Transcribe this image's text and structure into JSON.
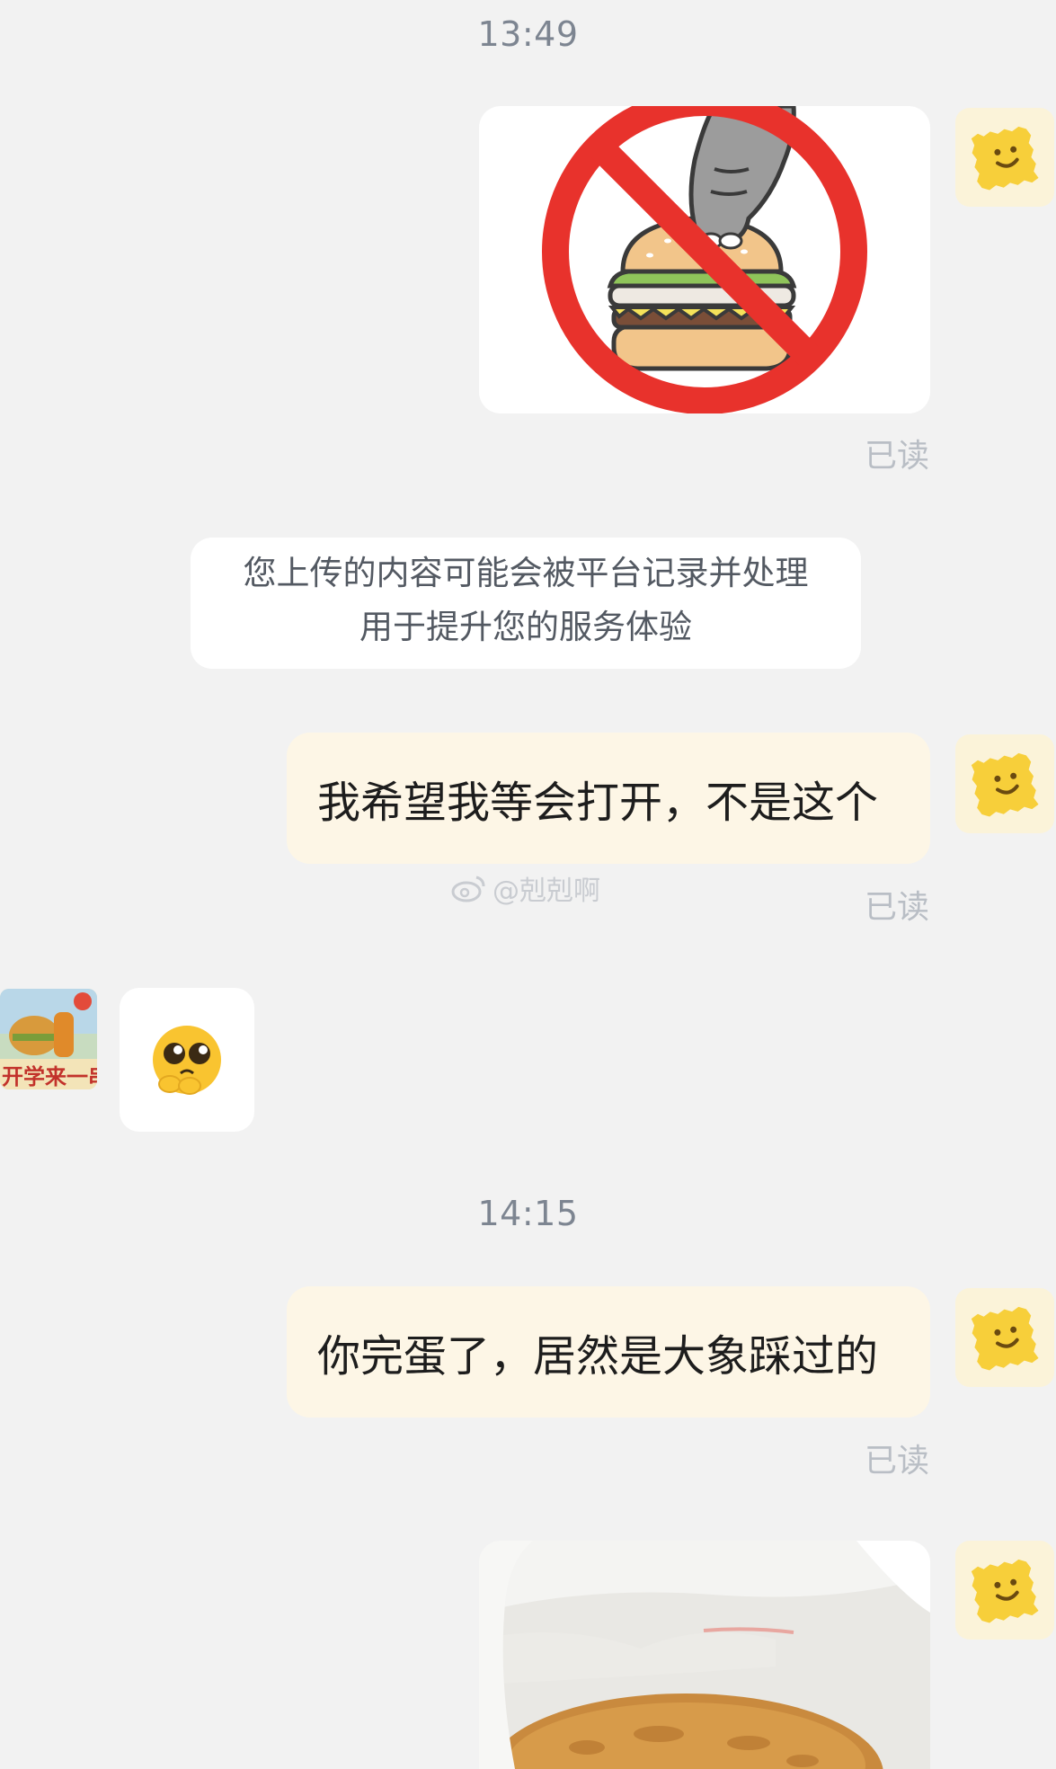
{
  "messages": {
    "time_1": "13:49",
    "read_1": "已读",
    "notice_line1": "您上传的内容可能会被平台记录并处理",
    "notice_line2": "用于提升您的服务体验",
    "msg_1": "我希望我等会打开，不是这个",
    "watermark": "@剋剋啊",
    "read_2": "已读",
    "time_2": "14:15",
    "msg_2": "你完蛋了，居然是大象踩过的",
    "read_3": "已读"
  },
  "other_avatar": {
    "caption": "开学来一串"
  },
  "colors": {
    "background": "#f2f2f2",
    "my_bubble": "#fdf6e6",
    "avatar_bg": "#fbf3d9",
    "avatar_face": "#f7cf3a",
    "prohibition_red": "#e8322c",
    "read_text": "#b9bec5",
    "time_text": "#7d8591"
  },
  "icons": {
    "my_avatar": "yellow-smiley-cracker-icon",
    "sticker": "prohibition-elephant-stepping-burger",
    "emoji": "pleading-face-emoji",
    "watermark": "weibo-icon"
  }
}
